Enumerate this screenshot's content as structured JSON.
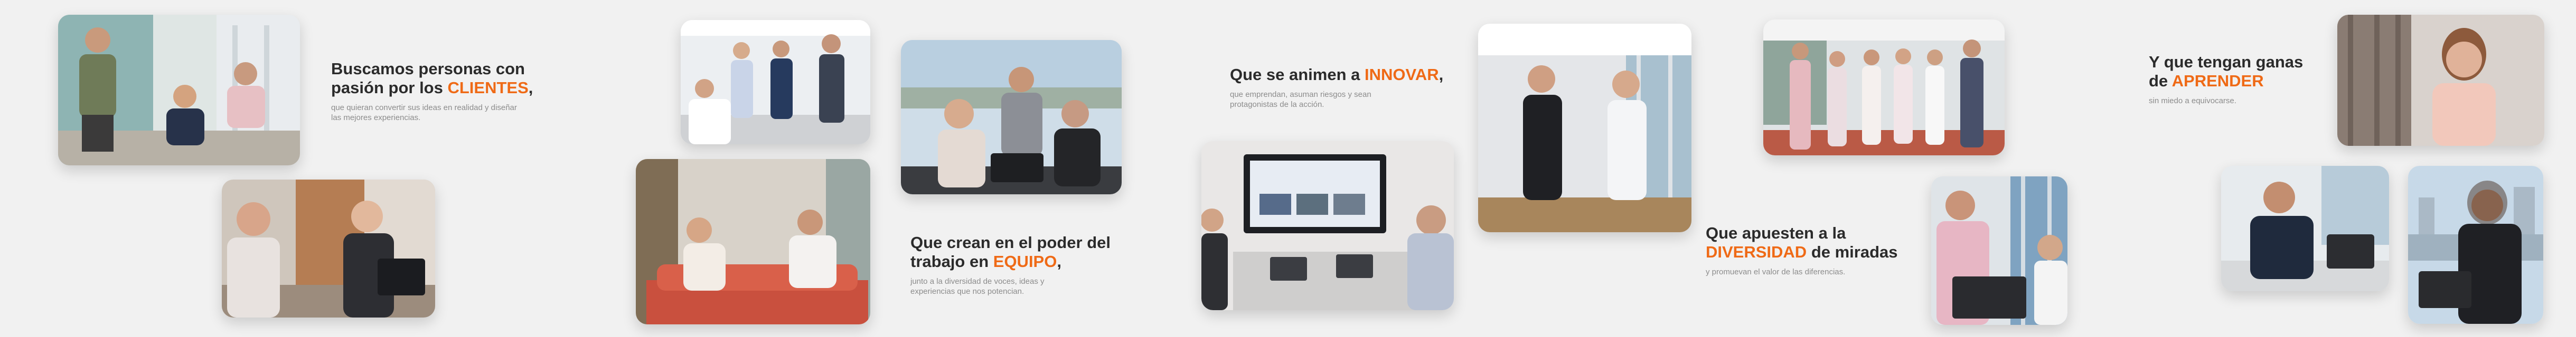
{
  "colors": {
    "accent": "#ef6a16",
    "text": "#2b2b2b",
    "muted": "#8c8c8c",
    "background": "#f1f1f1"
  },
  "blocks": [
    {
      "pre": "Buscamos personas con pasión por los ",
      "accent": "CLIENTES",
      "post": ",",
      "sub": "que quieran convertir sus ideas en realidad y diseñar las mejores experiencias."
    },
    {
      "pre": "Que crean en el poder del trabajo en ",
      "accent": "EQUIPO",
      "post": ",",
      "sub": "junto a la diversidad de voces, ideas y experiencias que nos potencian."
    },
    {
      "pre": "Que se animen a ",
      "accent": "INNOVAR",
      "post": ",",
      "sub": "que emprendan, asuman riesgos y sean protagonistas de la acción."
    },
    {
      "pre": "Que apuesten a la ",
      "accent": "DIVERSIDAD",
      "post": " de miradas",
      "sub": "y promuevan el valor de las diferencias."
    },
    {
      "pre": "Y que tengan ganas de ",
      "accent": "APRENDER",
      "post": "",
      "sub": "sin miedo a equivocarse."
    }
  ]
}
